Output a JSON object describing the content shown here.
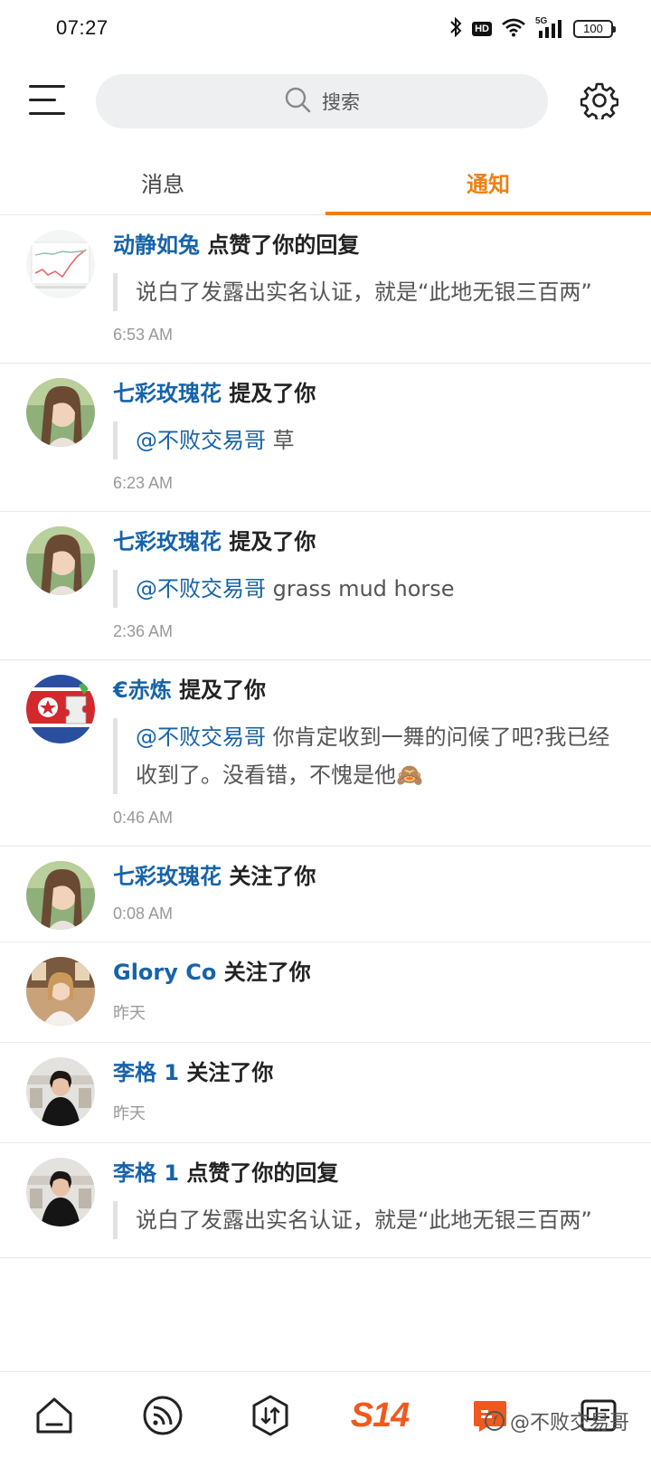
{
  "status_bar": {
    "time": "07:27",
    "hd_label": "HD",
    "network_label": "5G",
    "battery": "100"
  },
  "search": {
    "placeholder": "搜索"
  },
  "tabs": [
    {
      "label": "消息",
      "active": false
    },
    {
      "label": "通知",
      "active": true
    }
  ],
  "colors": {
    "accent": "#f07f12",
    "link": "#1763a9",
    "brand": "#f0591e"
  },
  "notifications": [
    {
      "user": "动静如兔",
      "action": "点赞了你的回复",
      "quote_mention": "",
      "quote": "说白了发露出实名认证，就是“此地无银三百两”",
      "time": "6:53 AM",
      "avatar": "chart-thumbnail"
    },
    {
      "user": "七彩玫瑰花",
      "action": "提及了你",
      "quote_mention": "@不败交易哥",
      "quote": " 草",
      "time": "6:23 AM",
      "avatar": "woman-portrait"
    },
    {
      "user": "七彩玫瑰花",
      "action": "提及了你",
      "quote_mention": "@不败交易哥",
      "quote": " grass mud horse",
      "time": "2:36 AM",
      "avatar": "woman-portrait"
    },
    {
      "user": "€赤炼",
      "action": "提及了你",
      "quote_mention": "@不败交易哥",
      "quote": " 你肯定收到一舞的问候了吧?我已经收到了。没看错，不愧是他🙈",
      "time": "0:46 AM",
      "avatar": "flag-puzzle"
    },
    {
      "user": "七彩玫瑰花",
      "action": "关注了你",
      "time": "0:08 AM",
      "avatar": "woman-portrait"
    },
    {
      "user": "Glory Co",
      "action": "关注了你",
      "time": "昨天",
      "avatar": "woman-cafe"
    },
    {
      "user": "李格 1",
      "action": "关注了你",
      "time": "昨天",
      "avatar": "woman-office"
    },
    {
      "user": "李格 1",
      "action": "点赞了你的回复",
      "quote_mention": "",
      "quote": "说白了发露出实名认证，就是“此地无银三百两”",
      "time": "",
      "avatar": "woman-office"
    }
  ],
  "bottom_nav": {
    "items": [
      "home-icon",
      "feed-icon",
      "trade-icon",
      "s14-logo",
      "messages-icon",
      "profile-icon"
    ],
    "s14_label": "S14",
    "watermark": "@不败交易哥"
  }
}
